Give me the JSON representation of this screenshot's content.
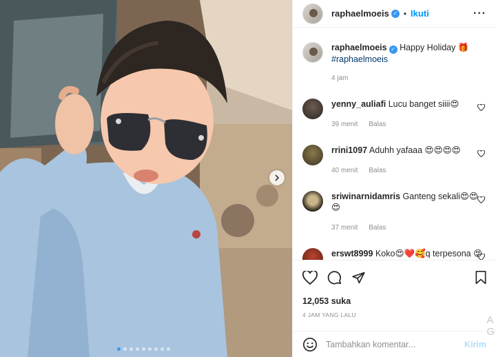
{
  "header": {
    "username": "raphaelmoeis",
    "verified": true,
    "follow_label": "Ikuti",
    "more_label": "···"
  },
  "caption": {
    "username": "raphaelmoeis",
    "text": "Happy Holiday 🎁",
    "hashtag": "#raphaelmoeis",
    "time": "4 jam"
  },
  "comments": [
    {
      "username": "yenny_auliafi",
      "text": "Lucu banget siiii😍",
      "time": "39 menit",
      "reply": "Balas"
    },
    {
      "username": "rrini1097",
      "text": "Aduhh yafaaa 😍😍😍😍",
      "time": "40 menit",
      "reply": "Balas"
    },
    {
      "username": "sriwinarnidamris",
      "text": "Ganteng sekali😍😍😍",
      "time": "37 menit",
      "reply": "Balas"
    },
    {
      "username": "erswt8999",
      "text": "Koko😍❤️🥰q terpesona 😍",
      "time": "",
      "reply": ""
    }
  ],
  "likes": "12,053 suka",
  "timestamp": "4 JAM YANG LALU",
  "add_comment": {
    "placeholder": "Tambahkan komentar...",
    "post_label": "Kirim"
  },
  "carousel": {
    "count": 9,
    "active": 0
  },
  "watermark": "A\nG",
  "colors": {
    "accent": "#0095f6",
    "verified": "#3897f0",
    "muted": "#8e8e8e"
  },
  "icons": [
    "heart-icon",
    "comment-icon",
    "share-icon",
    "bookmark-icon",
    "emoji-icon",
    "chevron-right-icon",
    "more-icon"
  ]
}
